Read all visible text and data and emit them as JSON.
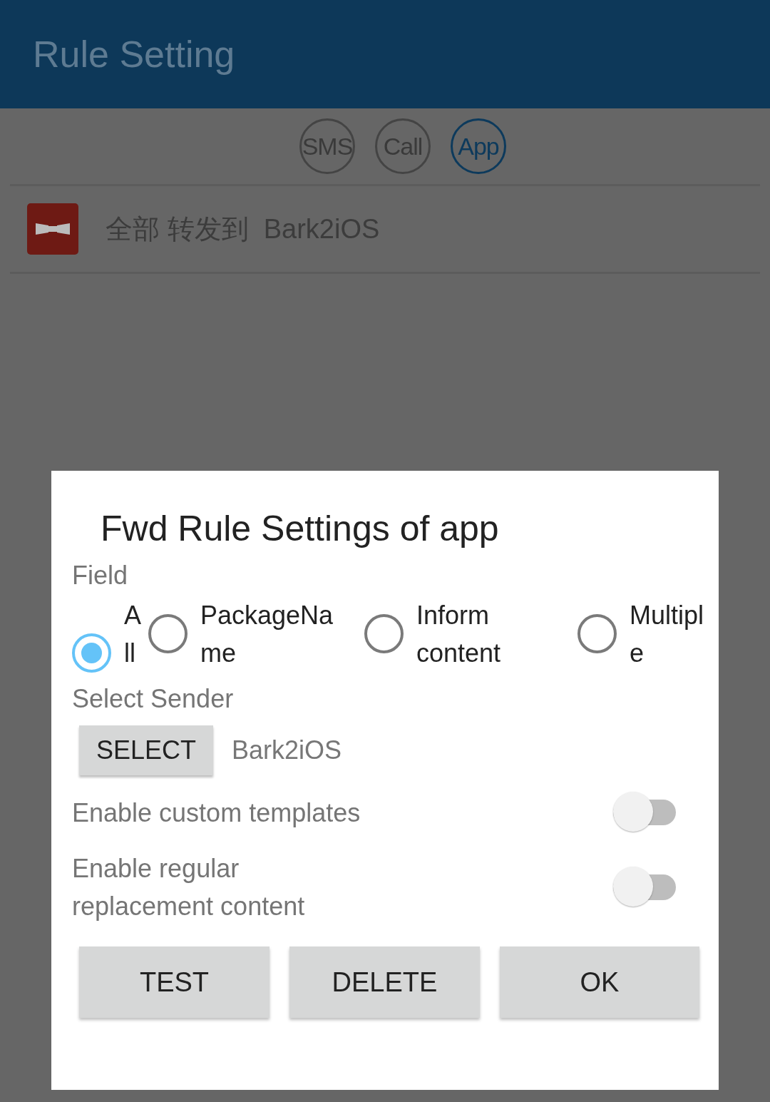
{
  "app_bar": {
    "title": "Rule Setting"
  },
  "type_tabs": [
    {
      "label": "SMS",
      "selected": false
    },
    {
      "label": "Call",
      "selected": false
    },
    {
      "label": "App",
      "selected": true
    }
  ],
  "rules": [
    {
      "text": "全部 转发到  Bark2iOS"
    }
  ],
  "dialog": {
    "title": "Fwd Rule Settings of app",
    "field_label": "Field",
    "field_options": [
      {
        "label": "All",
        "selected": true
      },
      {
        "label": "PackageName",
        "selected": false
      },
      {
        "label": "Inform content",
        "selected": false
      },
      {
        "label": "Multiple",
        "selected": false
      }
    ],
    "sender_label": "Select Sender",
    "select_button": "SELECT",
    "sender_value": "Bark2iOS",
    "switches": [
      {
        "label": "Enable custom templates",
        "on": false
      },
      {
        "label": "Enable regular replacement content",
        "on": false
      }
    ],
    "buttons": [
      "TEST",
      "DELETE",
      "OK"
    ]
  }
}
